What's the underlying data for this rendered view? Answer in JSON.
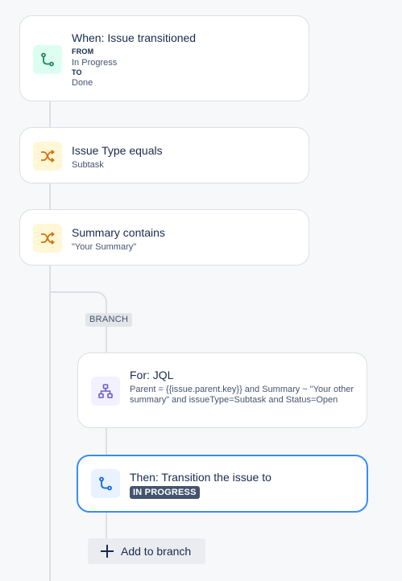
{
  "trigger": {
    "title": "When: Issue transitioned",
    "from_label": "FROM",
    "from_value": "In Progress",
    "to_label": "TO",
    "to_value": "Done",
    "icon": "transition-icon"
  },
  "condition_1": {
    "title": "Issue Type equals",
    "value": "Subtask",
    "icon": "shuffle-icon"
  },
  "condition_2": {
    "title": "Summary contains",
    "value": "\"Your Summary\"",
    "icon": "shuffle-icon"
  },
  "branch": {
    "tag": "BRANCH",
    "for_card": {
      "title": "For: JQL",
      "query": "Parent = {{issue.parent.key}} and Summary ~ \"Your other summary\" and issueType=Subtask and Status=Open",
      "icon": "hierarchy-icon"
    },
    "then_card": {
      "title": "Then: Transition the issue to",
      "status": "IN PROGRESS",
      "icon": "transition-icon"
    },
    "add_button": {
      "label": "Add to branch",
      "icon": "plus-icon"
    }
  },
  "colors": {
    "green_icon": "#1f845a",
    "yellow_icon": "#d97008",
    "purple_icon": "#6e5dc6",
    "blue_icon": "#0c66e4",
    "selected_border": "#388bff",
    "lozenge": "#44546f"
  }
}
